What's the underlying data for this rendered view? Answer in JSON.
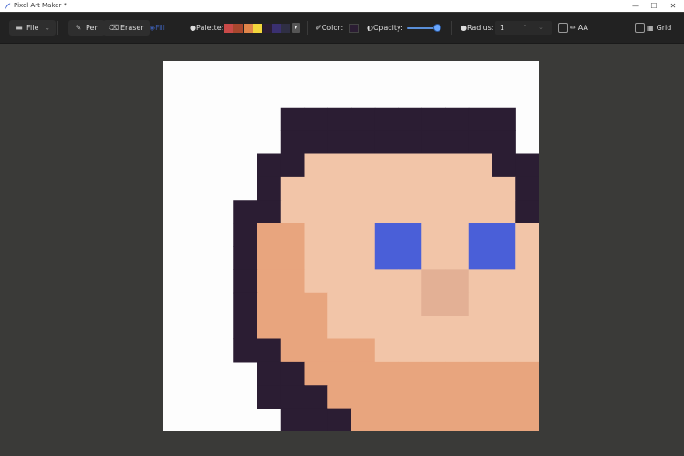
{
  "window": {
    "title": "Pixel Art Maker *",
    "minimize_glyph": "—",
    "maximize_glyph": "☐",
    "close_glyph": "✕"
  },
  "toolbar": {
    "file_label": "File",
    "pen_label": "Pen",
    "eraser_label": "Eraser",
    "fill_label": "Fill",
    "palette_label": "Palette:",
    "palette_colors": [
      "#c94a48",
      "#a8472e",
      "#e0854a",
      "#f2d53c",
      "#2b1d33",
      "#3a3070",
      "#2f2f44"
    ],
    "color_label": "Color:",
    "current_color": "#2b1d33",
    "opacity_label": "Opacity:",
    "opacity_value": 1.0,
    "radius_label": "Radius:",
    "radius_value": "1",
    "aa_label": "AA",
    "aa_checked": false,
    "grid_label": "Grid",
    "grid_checked": false
  },
  "canvas": {
    "background": "#fdfdfd",
    "colors": {
      "D": "#2b1d33",
      "S": "#f2c5a8",
      "s": "#f6d2bc",
      "T": "#e8a57e",
      "B": "#4a5fd8",
      "N": "#e3b095",
      "G": "#a5a898",
      "g": "#8f9486",
      "H": "#7e8379",
      "L": "#c9ccc4",
      "J": "#4460d8",
      "j": "#1f3ccf",
      "P": "#ffffff"
    },
    "grid": [
      "................",
      "................",
      ".....DDDDDDDDDD.",
      ".....DDDDDDDDDD.",
      "....DDSSSSSSSSDD",
      "....DSSSSSSSSSSD",
      "...DDSSSSSSSSSSD",
      "...DTTSSSBBSSBBS",
      "...DTTSSSBBSSBBS",
      "...DTTSSSSSNNSSS",
      "...DTTTSSSSNNSSS",
      "...DTTTSSSSSSSSS",
      "...DDTTTTSSSSSSS",
      "....DDTTTTTTTTTT",
      "....DDDTTTTTTTTT",
      ".....DDDTTTTTTTT"
    ]
  }
}
